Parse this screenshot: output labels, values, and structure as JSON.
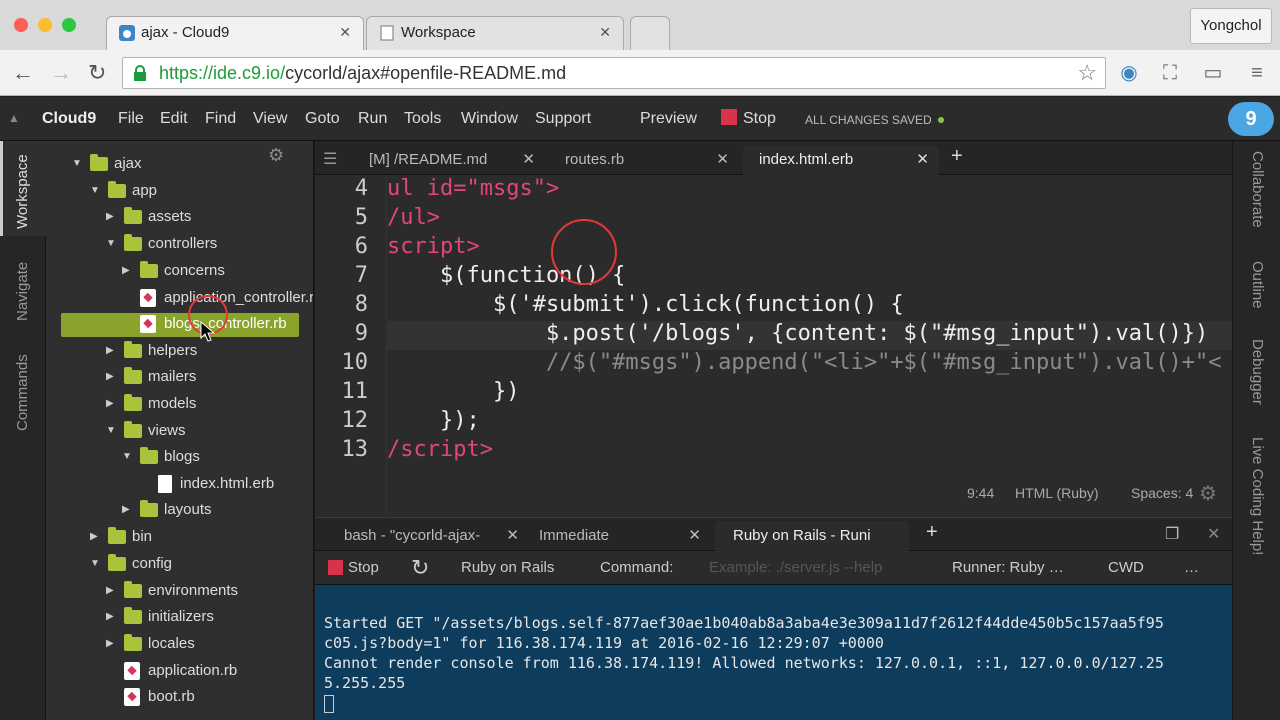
{
  "browser": {
    "tabs": [
      {
        "label": "ajax - Cloud9"
      },
      {
        "label": "Workspace"
      }
    ],
    "user": "Yongchol",
    "url": {
      "scheme_host": "https://ide.c9.io/",
      "path": "cycorld/ajax#openfile-README.md"
    }
  },
  "menu": {
    "brand": "Cloud9",
    "items": [
      "File",
      "Edit",
      "Find",
      "View",
      "Goto",
      "Run",
      "Tools",
      "Window",
      "Support"
    ],
    "preview": "Preview",
    "stop": "Stop",
    "status": "ALL CHANGES SAVED"
  },
  "left_rail": {
    "items": [
      "Workspace",
      "Navigate",
      "Commands"
    ]
  },
  "right_rail": {
    "items": [
      "Collaborate",
      "Outline",
      "Debugger",
      "Live Coding Help!"
    ]
  },
  "tree": [
    {
      "label": "ajax"
    },
    {
      "label": "app"
    },
    {
      "label": "assets"
    },
    {
      "label": "controllers"
    },
    {
      "label": "concerns"
    },
    {
      "label": "application_controller.rb"
    },
    {
      "label": "blogs_controller.rb"
    },
    {
      "label": "helpers"
    },
    {
      "label": "mailers"
    },
    {
      "label": "models"
    },
    {
      "label": "views"
    },
    {
      "label": "blogs"
    },
    {
      "label": "index.html.erb"
    },
    {
      "label": "layouts"
    },
    {
      "label": "bin"
    },
    {
      "label": "config"
    },
    {
      "label": "environments"
    },
    {
      "label": "initializers"
    },
    {
      "label": "locales"
    },
    {
      "label": "application.rb"
    },
    {
      "label": "boot.rb"
    }
  ],
  "editor": {
    "tabs": [
      {
        "label": "[M] /README.md"
      },
      {
        "label": "routes.rb"
      },
      {
        "label": "index.html.erb"
      }
    ],
    "lines": [
      {
        "n": "4",
        "text": "ul id=\"msgs\">"
      },
      {
        "n": "5",
        "text": "/ul>"
      },
      {
        "n": "6",
        "text": "script>"
      },
      {
        "n": "7",
        "text": "    $(function() {"
      },
      {
        "n": "8",
        "text": "        $('#submit').click(function() {"
      },
      {
        "n": "9",
        "text": "            $.post('/blogs', {content: $(\"#msg_input\").val()})"
      },
      {
        "n": "10",
        "text": "            //$(\"#msgs\").append(\"<li>\"+$(\"#msg_input\").val()+\"<"
      },
      {
        "n": "11",
        "text": "        })"
      },
      {
        "n": "12",
        "text": "    });"
      },
      {
        "n": "13",
        "text": "/script>"
      }
    ],
    "status": {
      "cursor": "9:44",
      "mode": "HTML (Ruby)",
      "spaces": "Spaces: 4"
    }
  },
  "console": {
    "tabs": [
      {
        "label": "bash - \"cycorld-ajax-"
      },
      {
        "label": "Immediate"
      },
      {
        "label": "Ruby on Rails - Runi"
      }
    ],
    "runbar": {
      "stop": "Stop",
      "runner_name": "Ruby on Rails",
      "command_label": "Command:",
      "command_placeholder": "Example: ./server.js --help",
      "runner": "Runner: Ruby …",
      "cwd": "CWD",
      "more": "…"
    },
    "output": [
      "Started GET \"/assets/blogs.self-877aef30ae1b040ab8a3aba4e3e309a11d7f2612f44dde450b5c157aa5f95",
      "c05.js?body=1\" for 116.38.174.119 at 2016-02-16 12:29:07 +0000",
      "Cannot render console from 116.38.174.119! Allowed networks: 127.0.0.1, ::1, 127.0.0.0/127.25",
      "5.255.255"
    ]
  },
  "colors": {
    "accent": "#a9c43a",
    "terminal_bg": "#0e3c5c",
    "tag": "#e0457b",
    "string": "#c8e64a",
    "keyword": "#a78bfa"
  }
}
